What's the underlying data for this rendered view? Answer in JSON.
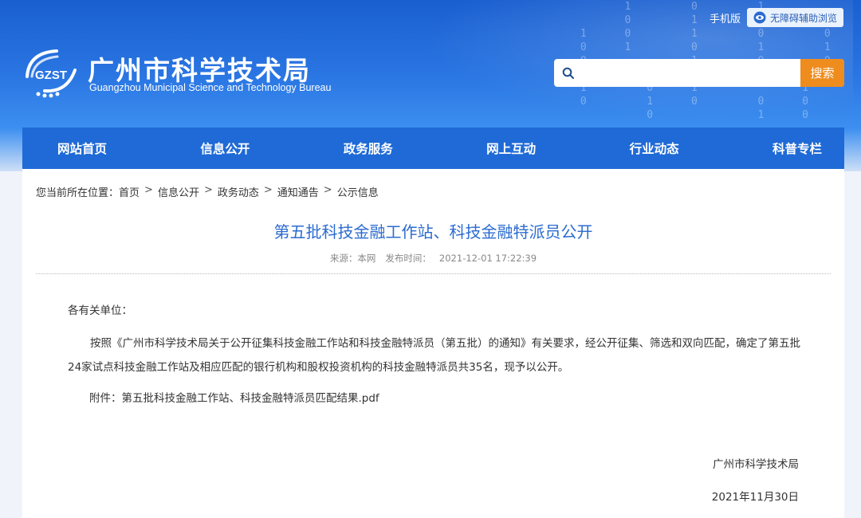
{
  "header": {
    "logo_text": "GZST",
    "title": "广州市科学技术局",
    "subtitle": "Guangzhou Municipal Science and Technology Bureau",
    "mobile_link": "手机版",
    "a11y_label": "无障碍辅助浏览",
    "search": {
      "placeholder": "",
      "button_label": "搜索"
    }
  },
  "nav": {
    "items": [
      "网站首页",
      "信息公开",
      "政务服务",
      "网上互动",
      "行业动态",
      "科普专栏"
    ]
  },
  "breadcrumb": {
    "prefix": "您当前所在位置：",
    "items": [
      "首页",
      "信息公开",
      "政务动态",
      "通知通告",
      "公示信息"
    ]
  },
  "article": {
    "title": "第五批科技金融工作站、科技金融特派员公开",
    "source_label": "来源：",
    "source": "本网",
    "publish_label": "发布时间：",
    "publish_time": "2021-12-01 17:22:39",
    "greeting": "各有关单位：",
    "body": "按照《广州市科学技术局关于公开征集科技金融工作站和科技金融特派员（第五批）的通知》有关要求，经公开征集、筛选和双向匹配，确定了第五批24家试点科技金融工作站及相应匹配的银行机构和股权投资机构的科技金融特派员共35名，现予以公开。",
    "attachment_label": "附件：",
    "attachment_name": "第五批科技金融工作站、科技金融特派员匹配结果.pdf",
    "signature": "广州市科学技术局",
    "date": "2021年11月30日"
  },
  "colors": {
    "brand_blue": "#1f6ad6",
    "title_blue": "#2b6bd1",
    "search_orange": "#ef8c1e"
  }
}
